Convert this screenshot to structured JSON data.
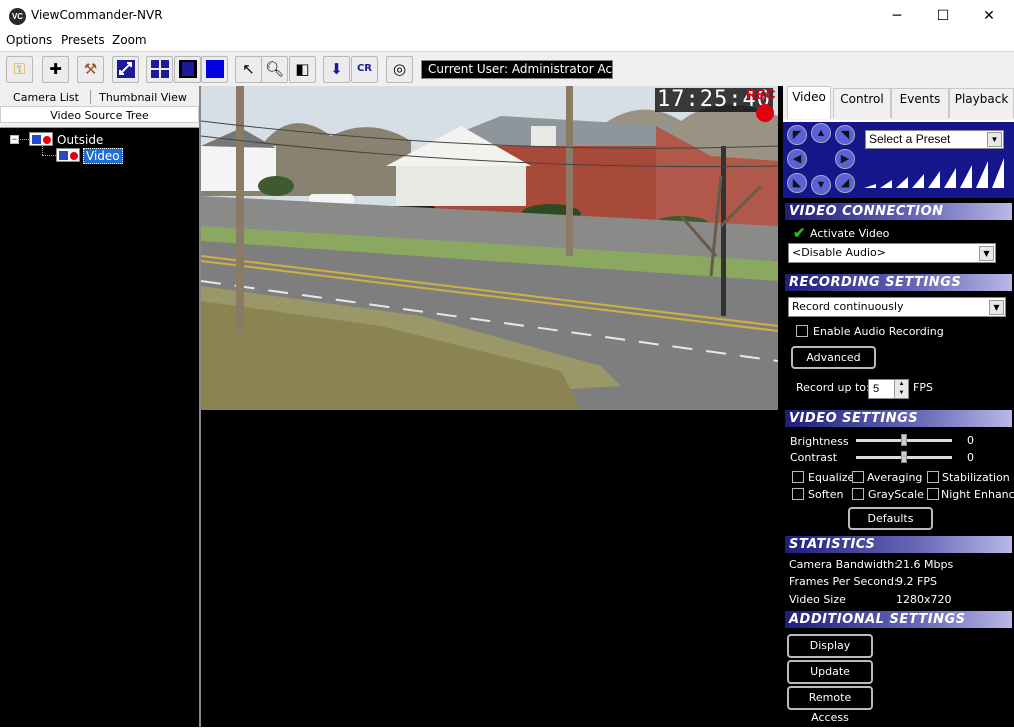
{
  "window": {
    "title": "ViewCommander-NVR",
    "icon_text": "VC",
    "controls": {
      "minimize": "─",
      "maximize": "☐",
      "close": "✕"
    }
  },
  "menu": [
    "Options",
    "Presets",
    "Zoom"
  ],
  "toolbar": {
    "icons": [
      "key-icon",
      "add-camera-icon",
      "tools-icon",
      "image-switch-icon",
      "quad-view-icon",
      "film-view-icon",
      "single-view-icon",
      "pointer-icon",
      "zoom-icon",
      "camera-record-icon",
      "download-icon",
      "cr-icon",
      "target-icon"
    ],
    "current_user": "Current User: Administrator Account"
  },
  "left_panel": {
    "tabs": [
      "Camera List",
      "Thumbnail View",
      "Video Source Tree"
    ],
    "tree": {
      "expander": "−",
      "root": "Outside",
      "child": "Video"
    }
  },
  "video": {
    "timestamp": "17:25:40",
    "rec_label": "REC",
    "rec_color": "#e00010"
  },
  "right_panel": {
    "tabs": [
      "Video",
      "Control",
      "Events",
      "Playback"
    ],
    "active_tab": "Video",
    "preset_placeholder": "Select a Preset",
    "video_connection": {
      "header": "VIDEO CONNECTION",
      "activate_label": "Activate Video",
      "audio_select": "<Disable Audio>"
    },
    "recording_settings": {
      "header": "RECORDING SETTINGS",
      "mode_select": "Record continuously",
      "audio_recording": "Enable Audio Recording",
      "advanced_button": "Advanced",
      "record_up_to": "Record up to:",
      "fps_value": "5",
      "fps_unit": "FPS"
    },
    "video_settings": {
      "header": "VIDEO SETTINGS",
      "brightness_label": "Brightness",
      "brightness_value": "0",
      "contrast_label": "Contrast",
      "contrast_value": "0",
      "checkboxes": [
        "Equalize",
        "Averaging",
        "Stabilization",
        "Soften",
        "GrayScale",
        "Night Enhance"
      ],
      "defaults_button": "Defaults"
    },
    "statistics": {
      "header": "STATISTICS",
      "rows": [
        {
          "label": "Camera Bandwidth:",
          "value": "21.6 Mbps"
        },
        {
          "label": "Frames Per Second:",
          "value": "9.2 FPS"
        },
        {
          "label": "Video Size",
          "value": "1280x720"
        }
      ]
    },
    "additional_settings": {
      "header": "ADDITIONAL SETTINGS",
      "buttons": [
        "Display Settings",
        "Update Presets",
        "Remote Access"
      ]
    }
  },
  "colors": {
    "section_header": "#1e1e7a",
    "ptz_background": "#14168a",
    "selection": "#1e6fd0",
    "check_green": "#2db52d"
  }
}
